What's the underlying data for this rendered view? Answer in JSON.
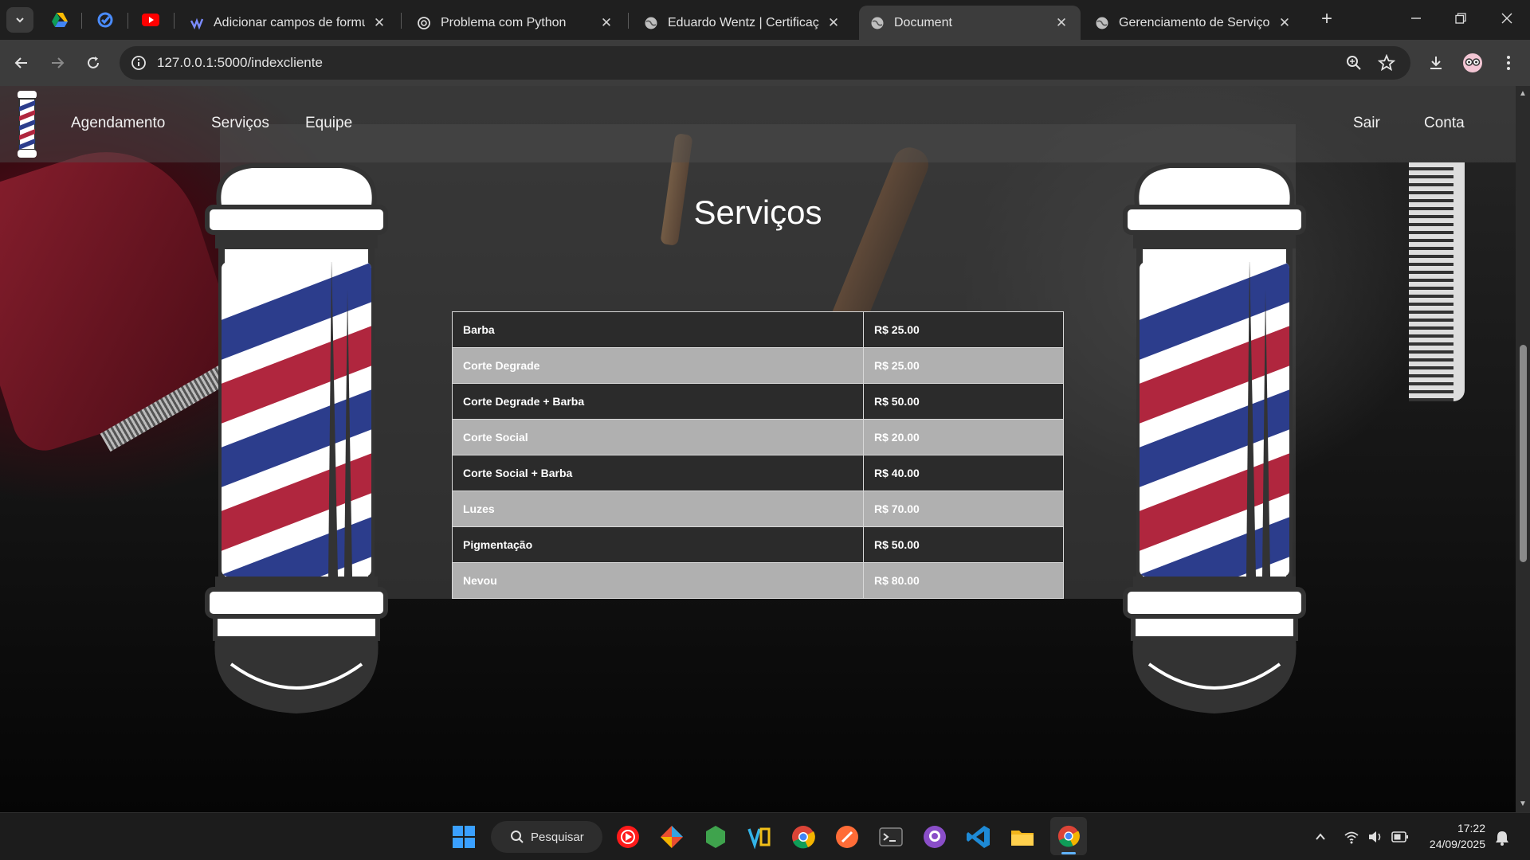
{
  "browser": {
    "tabs": [
      {
        "title": "Adicionar campos de formulá",
        "icon": "canva-icon"
      },
      {
        "title": "Problema com Python",
        "icon": "openai-icon"
      },
      {
        "title": "Eduardo Wentz | Certificações",
        "icon": "globe-icon"
      },
      {
        "title": "Document",
        "icon": "globe-icon",
        "active": true
      },
      {
        "title": "Gerenciamento de Serviços",
        "icon": "globe-icon"
      }
    ],
    "tab_close": "✕",
    "new_tab": "+",
    "url": "127.0.0.1:5000/indexcliente"
  },
  "site": {
    "nav": {
      "agendamento": "Agendamento",
      "servicos": "Serviços",
      "equipe": "Equipe",
      "sair": "Sair",
      "conta": "Conta"
    },
    "title": "Serviços",
    "services": [
      {
        "name": "Barba",
        "price": "R$ 25.00"
      },
      {
        "name": "Corte Degrade",
        "price": "R$ 25.00"
      },
      {
        "name": "Corte Degrade + Barba",
        "price": "R$ 50.00"
      },
      {
        "name": "Corte Social",
        "price": "R$ 20.00"
      },
      {
        "name": "Corte Social + Barba",
        "price": "R$ 40.00"
      },
      {
        "name": "Luzes",
        "price": "R$ 70.00"
      },
      {
        "name": "Pigmentação",
        "price": "R$ 50.00"
      },
      {
        "name": "Nevou",
        "price": "R$ 80.00"
      }
    ]
  },
  "taskbar": {
    "search_label": "Pesquisar",
    "time": "17:22",
    "date": "24/09/2025"
  },
  "colors": {
    "pole_red": "#b0263e",
    "pole_blue": "#2c3d8c",
    "tab_active": "#3c3c3c"
  }
}
